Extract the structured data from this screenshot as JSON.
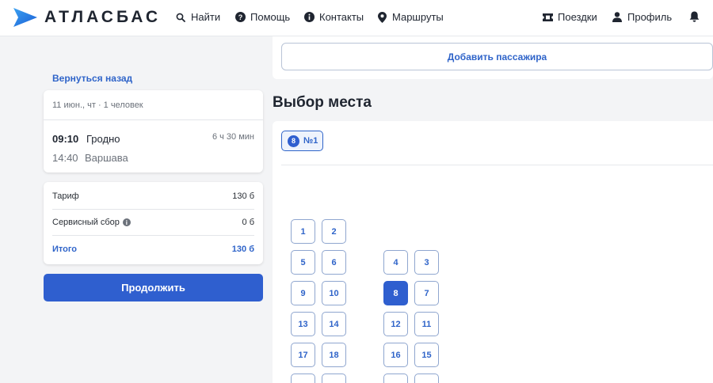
{
  "header": {
    "brand": "АТЛАСБАС",
    "nav": {
      "find": "Найти",
      "help": "Помощь",
      "contacts": "Контакты",
      "routes": "Маршруты",
      "trips": "Поездки",
      "profile": "Профиль"
    }
  },
  "sidebar": {
    "back_link": "Вернуться назад",
    "trip": {
      "summary": "11 июн., чт · 1 человек",
      "departure_time": "09:10",
      "departure_city": "Гродно",
      "arrival_time": "14:40",
      "arrival_city": "Варшава",
      "duration": "6 ч 30 мин"
    },
    "fare": {
      "tariff_label": "Тариф",
      "tariff_value": "130 б",
      "service_label": "Сервисный сбор",
      "service_value": "0 б",
      "total_label": "Итого",
      "total_value": "130 б"
    },
    "continue_label": "Продолжить"
  },
  "main": {
    "add_passenger_label": "Добавить пассажира",
    "section_title": "Выбор места",
    "passenger_chip": {
      "seat": "8",
      "label": "№1"
    },
    "seats": [
      "1",
      "2",
      "5",
      "6",
      "4",
      "3",
      "9",
      "10",
      "8",
      "7",
      "13",
      "14",
      "12",
      "11",
      "17",
      "18",
      "16",
      "15"
    ],
    "selected_seat": "8"
  },
  "colors": {
    "accent": "#2f5fcf",
    "link": "#2f64c9",
    "background": "#f3f4f6"
  }
}
